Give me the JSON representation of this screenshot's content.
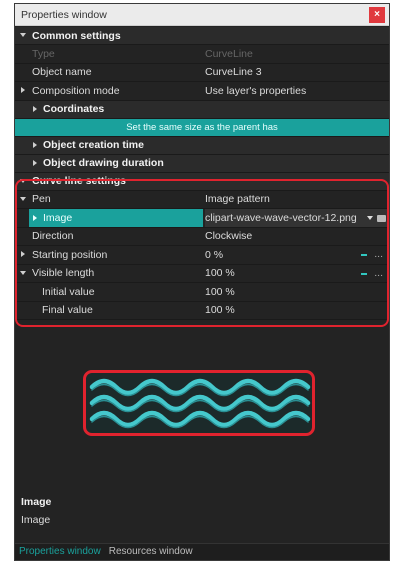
{
  "window": {
    "title": "Properties window",
    "close_label": "×"
  },
  "common": {
    "header": "Common settings",
    "type": {
      "name": "Type",
      "value": "CurveLine"
    },
    "object_name": {
      "name": "Object name",
      "value": "CurveLine 3"
    },
    "composition_mode": {
      "name": "Composition mode",
      "value": "Use layer's properties"
    },
    "coordinates": "Coordinates",
    "same_size_button": "Set the same size as the parent has",
    "object_creation_time": "Object creation time",
    "object_drawing_duration": "Object drawing duration"
  },
  "curve": {
    "header": "Curve line settings",
    "pen": {
      "name": "Pen",
      "value": "Image pattern"
    },
    "image": {
      "name": "Image",
      "value": "clipart-wave-wave-vector-12.png"
    },
    "direction": {
      "name": "Direction",
      "value": "Clockwise"
    },
    "starting_position": {
      "name": "Starting position",
      "value": "0 %"
    },
    "visible_length": {
      "name": "Visible length",
      "value": "100 %"
    },
    "initial_value": {
      "name": "Initial value",
      "value": "100 %"
    },
    "final_value": {
      "name": "Final value",
      "value": "100 %"
    },
    "ellipsis": "..."
  },
  "help": {
    "title": "Image",
    "description": "Image"
  },
  "tabs": {
    "properties": "Properties window",
    "resources": "Resources window"
  },
  "colors": {
    "accent": "#1aa19c",
    "highlight": "#e0232e",
    "wave": "#45c8cc",
    "background": "#232323"
  }
}
